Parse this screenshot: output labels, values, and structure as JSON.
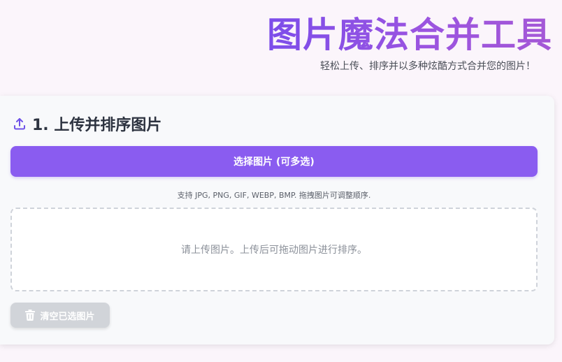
{
  "header": {
    "title": "图片魔法合并工具",
    "subtitle": "轻松上传、排序并以多种炫酷方式合并您的图片！"
  },
  "upload_section": {
    "icon": "upload-icon",
    "title": "1. 上传并排序图片",
    "select_button_label": "选择图片 (可多选)",
    "hint": "支持 JPG, PNG, GIF, WEBP, BMP. 拖拽图片可调整顺序.",
    "drop_zone_placeholder": "请上传图片。上传后可拖动图片进行排序。",
    "clear_button_icon": "trash-icon",
    "clear_button_label": "清空已选图片"
  },
  "colors": {
    "accent": "#8a5cf0",
    "title_gradient_start": "#7c4dea",
    "title_gradient_end": "#a458d6",
    "disabled_button": "#d1d4d9"
  }
}
